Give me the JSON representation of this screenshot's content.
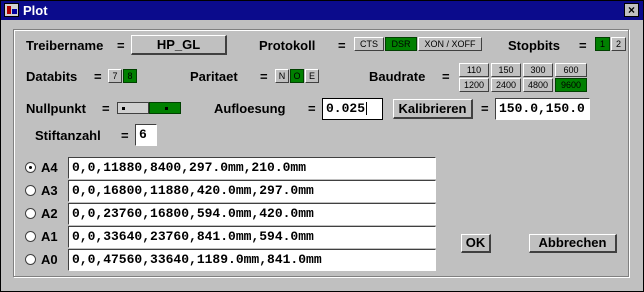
{
  "window": {
    "title": "Plot",
    "close_glyph": "×"
  },
  "treiber": {
    "label": "Treibername",
    "eq": "=",
    "value": "HP_GL"
  },
  "protokoll": {
    "label": "Protokoll",
    "eq": "=",
    "options": [
      {
        "label": "CTS",
        "selected": false
      },
      {
        "label": "DSR",
        "selected": true
      },
      {
        "label": "XON / XOFF",
        "selected": false
      }
    ]
  },
  "stopbits": {
    "label": "Stopbits",
    "eq": "=",
    "options": [
      {
        "label": "1",
        "selected": true
      },
      {
        "label": "2",
        "selected": false
      }
    ]
  },
  "databits": {
    "label": "Databits",
    "eq": "=",
    "options": [
      {
        "label": "7",
        "selected": false
      },
      {
        "label": "8",
        "selected": true
      }
    ]
  },
  "paritaet": {
    "label": "Paritaet",
    "eq": "=",
    "options": [
      {
        "label": "N",
        "selected": false
      },
      {
        "label": "O",
        "selected": true
      },
      {
        "label": "E",
        "selected": false
      }
    ]
  },
  "baudrate": {
    "label": "Baudrate",
    "eq": "=",
    "options": [
      {
        "label": "110",
        "selected": false
      },
      {
        "label": "150",
        "selected": false
      },
      {
        "label": "300",
        "selected": false
      },
      {
        "label": "600",
        "selected": false
      },
      {
        "label": "1200",
        "selected": false
      },
      {
        "label": "2400",
        "selected": false
      },
      {
        "label": "4800",
        "selected": false
      },
      {
        "label": "9600",
        "selected": true
      }
    ]
  },
  "nullpunkt": {
    "label": "Nullpunkt",
    "eq": "=",
    "selected": "right"
  },
  "aufloesung": {
    "label": "Aufloesung",
    "eq": "=",
    "value": "0.025"
  },
  "kalibrieren": {
    "button": "Kalibrieren",
    "eq": "=",
    "value": "150.0,150.0"
  },
  "stiftanzahl": {
    "label": "Stiftanzahl",
    "eq": "=",
    "value": "6"
  },
  "formats": [
    {
      "label": "A4",
      "selected": true,
      "value": "0,0,11880,8400,297.0mm,210.0mm"
    },
    {
      "label": "A3",
      "selected": false,
      "value": "0,0,16800,11880,420.0mm,297.0mm"
    },
    {
      "label": "A2",
      "selected": false,
      "value": "0,0,23760,16800,594.0mm,420.0mm"
    },
    {
      "label": "A1",
      "selected": false,
      "value": "0,0,33640,23760,841.0mm,594.0mm"
    },
    {
      "label": "A0",
      "selected": false,
      "value": "0,0,47560,33640,1189.0mm,841.0mm"
    }
  ],
  "buttons": {
    "ok": "OK",
    "cancel": "Abbrechen"
  }
}
